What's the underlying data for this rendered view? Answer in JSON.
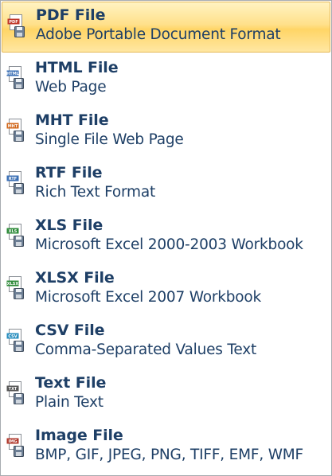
{
  "menu": {
    "items": [
      {
        "title": "PDF File",
        "description": "Adobe Portable Document Format",
        "icon": "pdf-file-icon",
        "tag": "PDF",
        "tag_color": "#c0392b",
        "highlighted": true
      },
      {
        "title": "HTML File",
        "description": "Web Page",
        "icon": "html-file-icon",
        "tag": "HTML",
        "tag_color": "#3a6fb5",
        "highlighted": false
      },
      {
        "title": "MHT File",
        "description": "Single File Web Page",
        "icon": "mht-file-icon",
        "tag": "MHT",
        "tag_color": "#d2691e",
        "highlighted": false
      },
      {
        "title": "RTF File",
        "description": "Rich Text Format",
        "icon": "rtf-file-icon",
        "tag": "RTF",
        "tag_color": "#3a6fb5",
        "highlighted": false
      },
      {
        "title": "XLS File",
        "description": "Microsoft Excel 2000-2003 Workbook",
        "icon": "xls-file-icon",
        "tag": "XLS",
        "tag_color": "#2e8b3a",
        "highlighted": false
      },
      {
        "title": "XLSX File",
        "description": "Microsoft Excel 2007 Workbook",
        "icon": "xlsx-file-icon",
        "tag": "XLSX",
        "tag_color": "#2e8b3a",
        "highlighted": false
      },
      {
        "title": "CSV File",
        "description": "Comma-Separated Values Text",
        "icon": "csv-file-icon",
        "tag": "CSV",
        "tag_color": "#2a8fbf",
        "highlighted": false
      },
      {
        "title": "Text File",
        "description": "Plain Text",
        "icon": "txt-file-icon",
        "tag": "TXT",
        "tag_color": "#555555",
        "highlighted": false
      },
      {
        "title": "Image File",
        "description": "BMP, GIF, JPEG, PNG, TIFF, EMF, WMF",
        "icon": "image-file-icon",
        "tag": "IMG",
        "tag_color": "#b03a2e",
        "highlighted": false
      }
    ]
  },
  "colors": {
    "text": "#1e3f66",
    "highlight_border": "#e6b957",
    "highlight_fill": "#ffe08a",
    "menu_border": "#a7abb0"
  }
}
